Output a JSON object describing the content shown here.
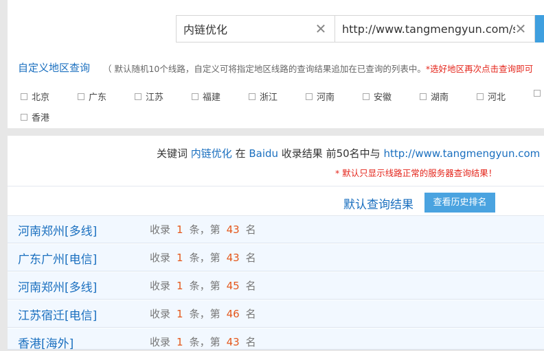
{
  "search": {
    "keyword_value": "内链优化",
    "url_value": "http://www.tangmengyun.com/s",
    "clear_glyph": "✕"
  },
  "region": {
    "title": "自定义地区查询",
    "desc_prefix": "（ 默认随机10个线路，自定义可将指定地区线路的查询结果追加在已查询的列表中。",
    "desc_red": "*选好地区再次点击查询即可",
    "options": [
      "北京",
      "广东",
      "江苏",
      "福建",
      "浙江",
      "河南",
      "安徽",
      "湖南",
      "河北",
      "香港"
    ]
  },
  "summary": {
    "prefix": "关键词 ",
    "keyword": "内链优化",
    "mid1": " 在 ",
    "engine": "Baidu",
    "mid2": " 收录结果 前50名中与 ",
    "url": "http://www.tangmengyun.com"
  },
  "note": "* 默认只显示线路正常的服务器查询结果！",
  "default_title": "默认查询结果",
  "history_button": "查看历史排名",
  "result_labels": {
    "a": "收录",
    "b": "条，第",
    "c": "名"
  },
  "rows": [
    {
      "location": "河南郑州[多线]",
      "count": "1",
      "rank": "43"
    },
    {
      "location": "广东广州[电信]",
      "count": "1",
      "rank": "43"
    },
    {
      "location": "河南郑州[多线]",
      "count": "1",
      "rank": "45"
    },
    {
      "location": "江苏宿迁[电信]",
      "count": "1",
      "rank": "46"
    },
    {
      "location": "香港[海外]",
      "count": "1",
      "rank": "43"
    }
  ]
}
